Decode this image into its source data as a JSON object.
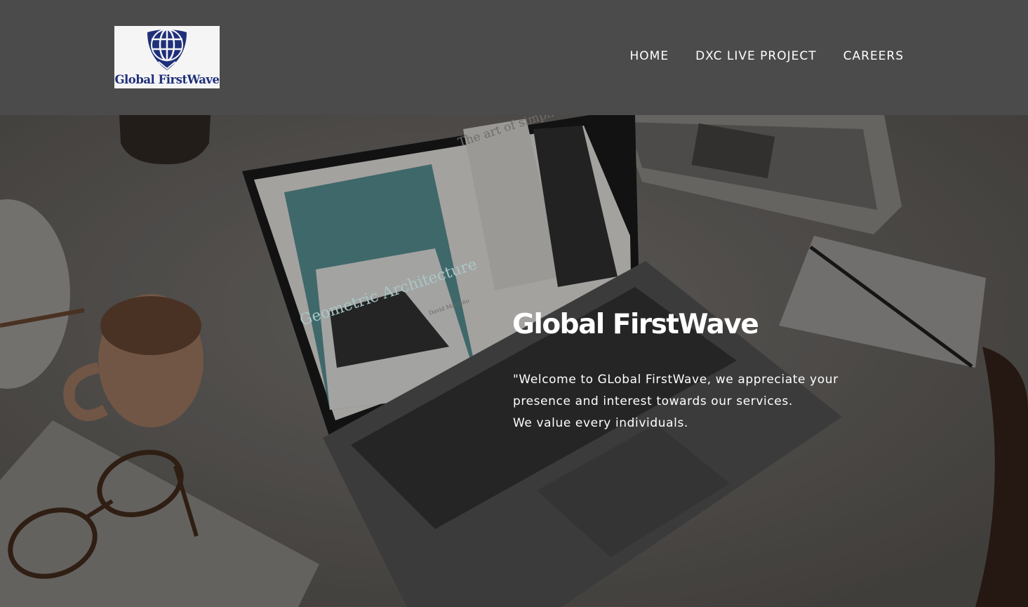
{
  "header": {
    "logo_text": "Global FirstWave",
    "nav": [
      {
        "label": "HOME"
      },
      {
        "label": "DXC LIVE PROJECT"
      },
      {
        "label": "CAREERS"
      }
    ]
  },
  "hero": {
    "title": "Global FirstWave",
    "lines": [
      "\"Welcome to GLobal FirstWave, we appreciate your",
      "presence and interest towards our services.",
      "We value every individuals."
    ],
    "laptop_screen": {
      "heading": "Geometric Architecture",
      "article_title": "The art of simplicity",
      "author": "David Mariano"
    }
  },
  "colors": {
    "header_bg": "#4b4b4b",
    "logo_blue": "#1f2f7a",
    "text": "#ffffff"
  }
}
